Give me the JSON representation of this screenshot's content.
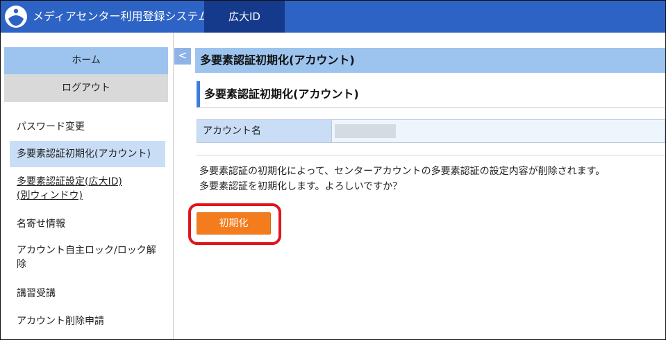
{
  "header": {
    "app_title": "メディアセンター利用登録システム",
    "id_tab": "広大ID",
    "logo_icon": "university-logo-icon"
  },
  "sidebar": {
    "home": "ホーム",
    "logout": "ログアウト",
    "items": [
      {
        "label": "パスワード変更"
      },
      {
        "label": "多要素認証初期化(アカウント)",
        "active": true
      },
      {
        "label_line1": "多要素認証設定(広大ID)",
        "label_line2": "(別ウィンドウ)",
        "link": true
      },
      {
        "label": "名寄せ情報"
      },
      {
        "label_line1": "アカウント自主ロック/ロック解",
        "label_line2": "除"
      },
      {
        "label": "講習受講"
      },
      {
        "label": "アカウント削除申請"
      }
    ]
  },
  "collapse": {
    "icon": "chevron-left-icon",
    "glyph": "<"
  },
  "main": {
    "page_title": "多要素認証初期化(アカウント)",
    "section_title": "多要素認証初期化(アカウント)",
    "account_label": "アカウント名",
    "message_line1": "多要素認証の初期化によって、センターアカウントの多要素認証の設定内容が削除されます。",
    "message_line2": "多要素認証を初期化します。よろしいですか？",
    "init_button": "初期化"
  },
  "colors": {
    "header": "#2d63c4",
    "header_tab": "#153a8c",
    "nav_highlight": "#9cc4ee",
    "button": "#f47c1c",
    "annotation": "#e0141c"
  }
}
